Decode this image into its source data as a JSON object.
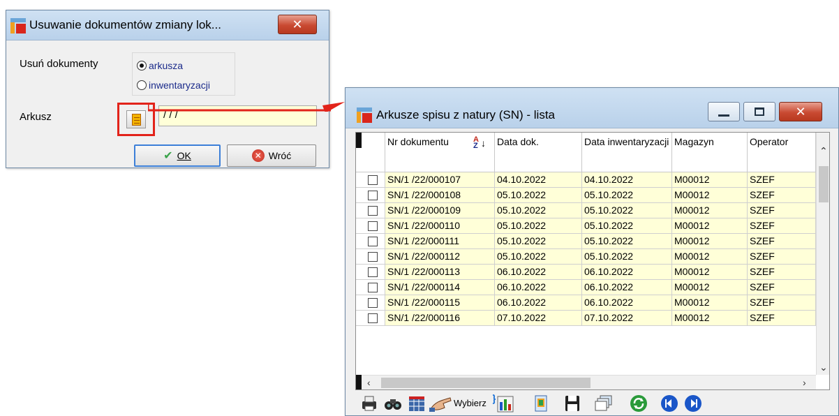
{
  "dialog": {
    "title": "Usuwanie dokumentów zmiany lok...",
    "close_label": "✕",
    "usun_label": "Usuń dokumenty",
    "radio_options": [
      "arkusza",
      "inwentaryzacji"
    ],
    "selected_option": "arkusza",
    "arkusz_label": "Arkusz",
    "arkusz_value": "/ / /",
    "ok_label": "OK",
    "back_label": "Wróć"
  },
  "list_window": {
    "title": "Arkusze spisu z natury (SN) - lista",
    "columns": [
      "Nr dokumentu",
      "Data dok.",
      "Data inwentaryzacji",
      "Magazyn",
      "Operator"
    ],
    "rows": [
      [
        "SN/1  /22/000107",
        "04.10.2022",
        "04.10.2022",
        "M00012",
        "SZEF"
      ],
      [
        "SN/1  /22/000108",
        "05.10.2022",
        "05.10.2022",
        "M00012",
        "SZEF"
      ],
      [
        "SN/1  /22/000109",
        "05.10.2022",
        "05.10.2022",
        "M00012",
        "SZEF"
      ],
      [
        "SN/1  /22/000110",
        "05.10.2022",
        "05.10.2022",
        "M00012",
        "SZEF"
      ],
      [
        "SN/1  /22/000111",
        "05.10.2022",
        "05.10.2022",
        "M00012",
        "SZEF"
      ],
      [
        "SN/1  /22/000112",
        "05.10.2022",
        "05.10.2022",
        "M00012",
        "SZEF"
      ],
      [
        "SN/1  /22/000113",
        "06.10.2022",
        "06.10.2022",
        "M00012",
        "SZEF"
      ],
      [
        "SN/1  /22/000114",
        "06.10.2022",
        "06.10.2022",
        "M00012",
        "SZEF"
      ],
      [
        "SN/1  /22/000115",
        "06.10.2022",
        "06.10.2022",
        "M00012",
        "SZEF"
      ],
      [
        "SN/1  /22/000116",
        "07.10.2022",
        "07.10.2022",
        "M00012",
        "SZEF"
      ]
    ],
    "toolbar": {
      "wybierz_label": "Wybierz",
      "icons": [
        "print-icon",
        "binoculars-icon",
        "calendar-grid-icon",
        "pointing-hand-icon",
        "chart-icon",
        "document-icon",
        "save-icon",
        "windows-icon",
        "refresh-icon",
        "prev-icon",
        "next-icon"
      ]
    }
  },
  "colors": {
    "field_bg": "#ffffd8",
    "highlight": "#e2231a",
    "title_bar": "#c4d9ef"
  }
}
